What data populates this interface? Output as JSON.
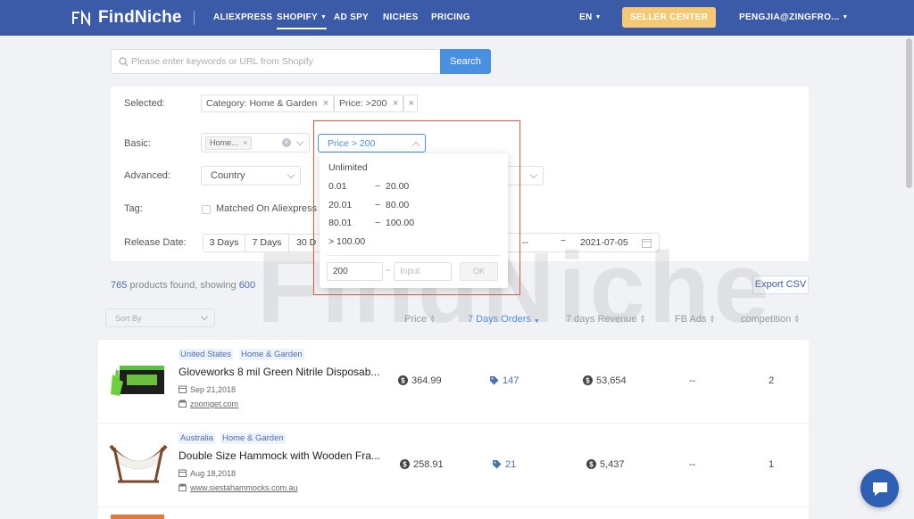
{
  "nav": {
    "logo": "FindNiche",
    "items": [
      "ALIEXPRESS",
      "SHOPIFY",
      "AD SPY",
      "NICHES",
      "PRICING"
    ],
    "language": "EN",
    "seller_center": "SELLER CENTER",
    "user": "PENGJIA@ZINGFRO..."
  },
  "search": {
    "placeholder": "Please enter keywords or URL from Shopify",
    "button": "Search"
  },
  "filters": {
    "selected_label": "Selected:",
    "selected_tags": [
      "Category: Home & Garden",
      "Price: >200"
    ],
    "basic_label": "Basic:",
    "category_chip": "Home...",
    "price_select": "Price > 200",
    "advanced_label": "Advanced:",
    "country_placeholder": "Country",
    "tag_label": "Tag:",
    "matched_label": "Matched On Aliexpress",
    "release_label": "Release Date:",
    "day_buttons": [
      "3 Days",
      "7 Days",
      "30 D"
    ],
    "date_start": "--",
    "date_sep": "~",
    "date_end": "2021-07-05"
  },
  "price_popup": {
    "unlimited": "Unlimited",
    "ranges": [
      {
        "low": "0.01",
        "high": "20.00"
      },
      {
        "low": "20.01",
        "high": "80.00"
      },
      {
        "low": "80.01",
        "high": "100.00"
      }
    ],
    "over": "> 100.00",
    "range_sep": "~",
    "min_value": "200",
    "max_placeholder": "Input",
    "ok": "OK"
  },
  "results": {
    "count": "765",
    "text_mid": " products found, showing ",
    "showing": "600",
    "export": "Export CSV",
    "sort_placeholder": "Sort By",
    "columns": [
      "Price",
      "7 Days Orders",
      "7 days Revenue",
      "FB Ads",
      "competition"
    ]
  },
  "products": [
    {
      "country": "United States",
      "category": "Home & Garden",
      "title": "Gloveworks 8 mil Green Nitrile Disposab...",
      "date": "Sep 21,2018",
      "domain": "zoomget.com",
      "price": "364.99",
      "orders": "147",
      "revenue": "53,654",
      "fb_ads": "--",
      "competition": "2"
    },
    {
      "country": "Australia",
      "category": "Home & Garden",
      "title": "Double Size Hammock with Wooden Fra...",
      "date": "Aug 18,2018",
      "domain": "www.siestahammocks.com.au",
      "price": "258.91",
      "orders": "21",
      "revenue": "5,437",
      "fb_ads": "--",
      "competition": "1"
    }
  ],
  "watermark": "FindNiche",
  "colors": {
    "nav_bg": "#3b5aa8",
    "accent": "#4a90e2",
    "seller_btn": "#f5c974",
    "highlight": "#e0553b"
  }
}
